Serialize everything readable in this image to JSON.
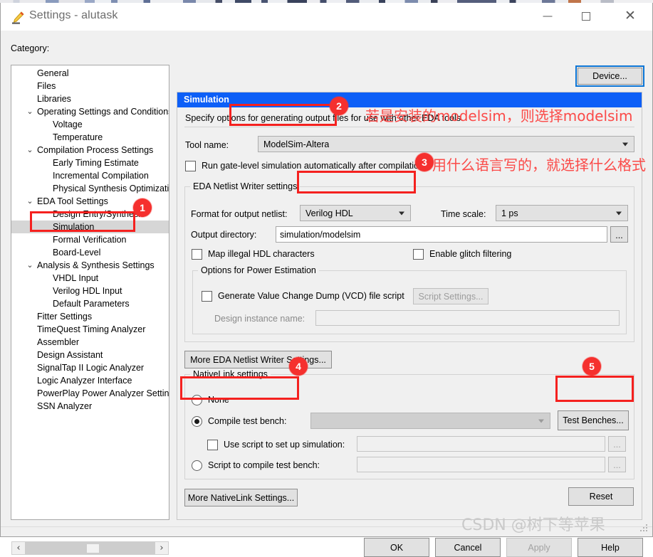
{
  "window": {
    "title": "Settings - alutask",
    "icon": "pencil-icon",
    "minimize_label": "Minimize",
    "maximize_label": "Maximize",
    "close_label": "Close"
  },
  "category": {
    "label": "Category:",
    "selected": "Simulation",
    "items": [
      {
        "label": "General",
        "level": 1,
        "chevron": ""
      },
      {
        "label": "Files",
        "level": 1,
        "chevron": ""
      },
      {
        "label": "Libraries",
        "level": 1,
        "chevron": ""
      },
      {
        "label": "Operating Settings and Conditions",
        "level": 1,
        "chevron": "⌄"
      },
      {
        "label": "Voltage",
        "level": 2,
        "chevron": ""
      },
      {
        "label": "Temperature",
        "level": 2,
        "chevron": ""
      },
      {
        "label": "Compilation Process Settings",
        "level": 1,
        "chevron": "⌄"
      },
      {
        "label": "Early Timing Estimate",
        "level": 2,
        "chevron": ""
      },
      {
        "label": "Incremental Compilation",
        "level": 2,
        "chevron": ""
      },
      {
        "label": "Physical Synthesis Optimization",
        "level": 2,
        "chevron": ""
      },
      {
        "label": "EDA Tool Settings",
        "level": 1,
        "chevron": "⌄"
      },
      {
        "label": "Design Entry/Synthesis",
        "level": 2,
        "chevron": ""
      },
      {
        "label": "Simulation",
        "level": 2,
        "chevron": ""
      },
      {
        "label": "Formal Verification",
        "level": 2,
        "chevron": ""
      },
      {
        "label": "Board-Level",
        "level": 2,
        "chevron": ""
      },
      {
        "label": "Analysis & Synthesis Settings",
        "level": 1,
        "chevron": "⌄"
      },
      {
        "label": "VHDL Input",
        "level": 2,
        "chevron": ""
      },
      {
        "label": "Verilog HDL Input",
        "level": 2,
        "chevron": ""
      },
      {
        "label": "Default Parameters",
        "level": 2,
        "chevron": ""
      },
      {
        "label": "Fitter Settings",
        "level": 1,
        "chevron": ""
      },
      {
        "label": "TimeQuest Timing Analyzer",
        "level": 1,
        "chevron": ""
      },
      {
        "label": "Assembler",
        "level": 1,
        "chevron": ""
      },
      {
        "label": "Design Assistant",
        "level": 1,
        "chevron": ""
      },
      {
        "label": "SignalTap II Logic Analyzer",
        "level": 1,
        "chevron": ""
      },
      {
        "label": "Logic Analyzer Interface",
        "level": 1,
        "chevron": ""
      },
      {
        "label": "PowerPlay Power Analyzer Settings",
        "level": 1,
        "chevron": ""
      },
      {
        "label": "SSN Analyzer",
        "level": 1,
        "chevron": ""
      }
    ],
    "scroll_left_glyph": "‹",
    "scroll_right_glyph": "›"
  },
  "device_button": "Device...",
  "pane": {
    "header": "Simulation",
    "description": "Specify options for generating output files for use with other EDA tools.",
    "tool_name_label": "Tool name:",
    "tool_name_value": "ModelSim-Altera",
    "run_gatelevel_label": "Run gate-level simulation automatically after compilation",
    "run_gatelevel_checked": false
  },
  "netlist_writer": {
    "group_title": "EDA Netlist Writer settings",
    "format_label": "Format for output netlist:",
    "format_value": "Verilog HDL",
    "timescale_label": "Time scale:",
    "timescale_value": "1 ps",
    "output_dir_label": "Output directory:",
    "output_dir_value": "simulation/modelsim",
    "browse_label": "...",
    "map_illegal_label": "Map illegal HDL characters",
    "map_illegal_checked": false,
    "glitch_label": "Enable glitch filtering",
    "glitch_checked": false
  },
  "power_estimation": {
    "group_title": "Options for Power Estimation",
    "vcd_label": "Generate Value Change Dump (VCD) file script",
    "vcd_checked": false,
    "script_settings_label": "Script Settings...",
    "design_instance_label": "Design instance name:",
    "design_instance_value": ""
  },
  "more_eda_button": "More EDA Netlist Writer Settings...",
  "nativelink": {
    "group_title": "NativeLink settings",
    "none_label": "None",
    "compile_tb_label": "Compile test bench:",
    "compile_tb_value": "",
    "selected_radio": "compile-test-bench",
    "test_benches_button": "Test Benches...",
    "use_script_label": "Use script to set up simulation:",
    "use_script_checked": false,
    "use_script_value": "",
    "script_compile_label": "Script to compile test bench:",
    "script_compile_value": "",
    "browse_label": "..."
  },
  "more_nativelink_button": "More NativeLink Settings...",
  "reset_button": "Reset",
  "footer": {
    "ok": "OK",
    "cancel": "Cancel",
    "apply": "Apply",
    "apply_disabled": true,
    "help": "Help"
  },
  "annotations": {
    "accent_color": "#f5302e",
    "badges": [
      {
        "n": "1",
        "target": "category-tree-simulation"
      },
      {
        "n": "2",
        "target": "tool-name-combo"
      },
      {
        "n": "3",
        "target": "format-output-netlist-combo"
      },
      {
        "n": "4",
        "target": "compile-test-bench-radio"
      },
      {
        "n": "5",
        "target": "test-benches-button"
      }
    ],
    "note_tool_name": "若是安装的modelsim，则选择modelsim",
    "note_format": "用什么语言写的，就选择什么格式"
  },
  "watermark": "CSDN @树下等苹果"
}
